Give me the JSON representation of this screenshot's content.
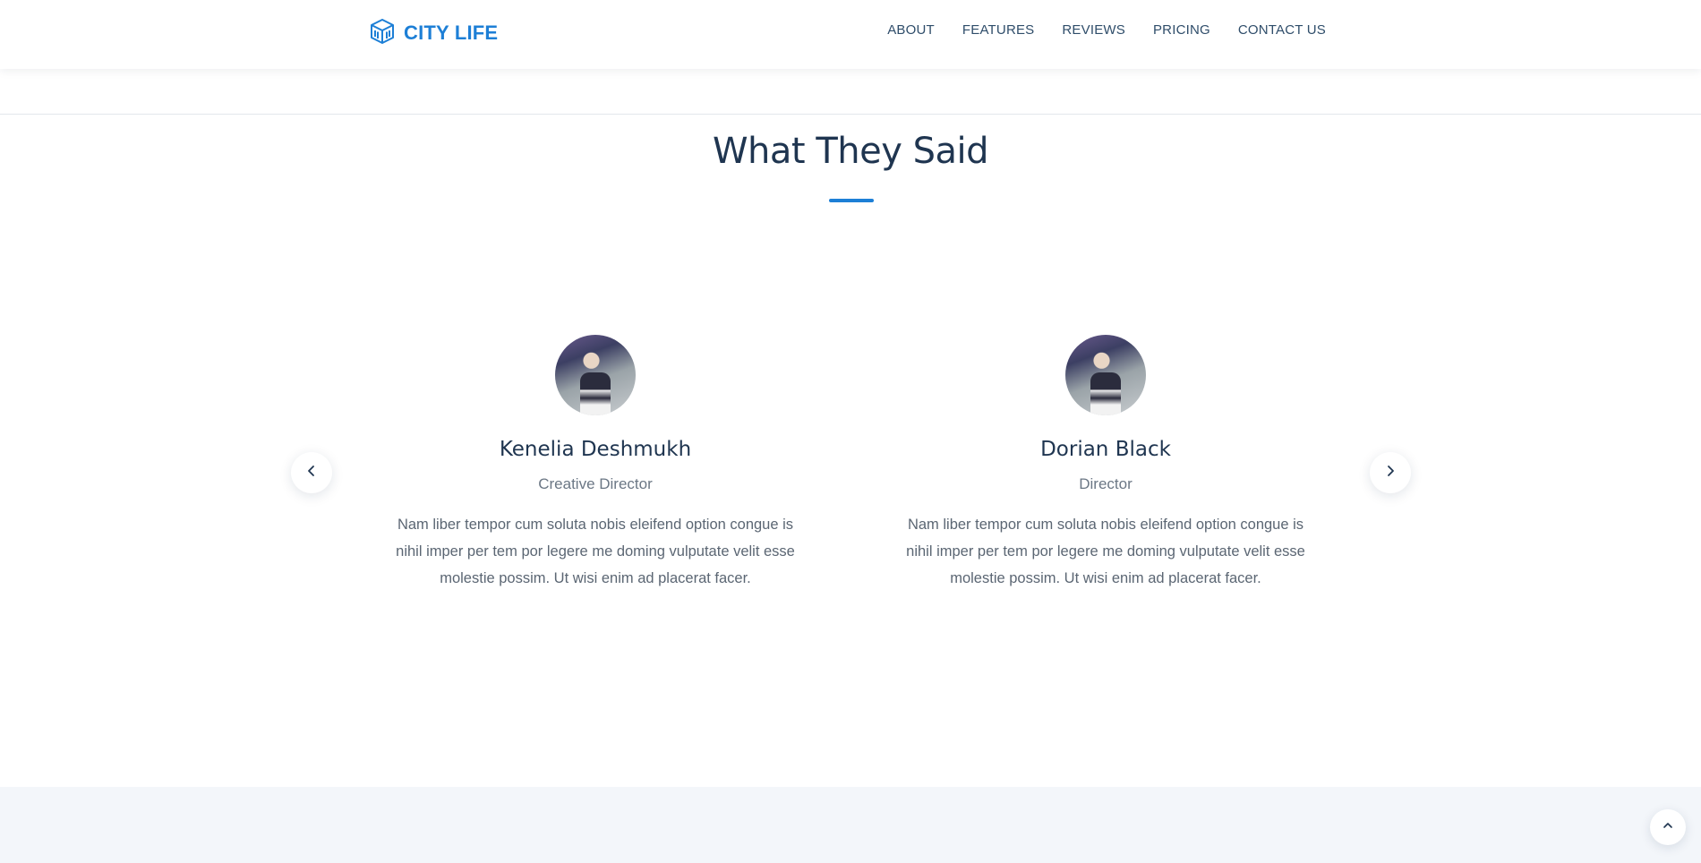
{
  "brand": {
    "name": "CITY LIFE",
    "logo_icon": "building-cube-icon",
    "color": "#1d7fd6"
  },
  "nav": {
    "items": [
      {
        "label": "ABOUT"
      },
      {
        "label": "FEATURES"
      },
      {
        "label": "REVIEWS"
      },
      {
        "label": "PRICING"
      },
      {
        "label": "CONTACT US"
      }
    ]
  },
  "testimonials": {
    "title": "What They Said",
    "prev_icon": "chevron-left-icon",
    "next_icon": "chevron-right-icon",
    "items": [
      {
        "name": "Kenelia Deshmukh",
        "role": "Creative Director",
        "quote": "Nam liber tempor cum soluta nobis eleifend option congue is nihil imper per tem por legere me doming vulputate velit esse molestie possim. Ut wisi enim ad placerat facer."
      },
      {
        "name": "Dorian Black",
        "role": "Director",
        "quote": "Nam liber tempor cum soluta nobis eleifend option congue is nihil imper per tem por legere me doming vulputate velit esse molestie possim. Ut wisi enim ad placerat facer."
      }
    ]
  },
  "scroll_top": {
    "icon": "chevron-up-icon"
  },
  "colors": {
    "accent": "#1d7fd6",
    "heading": "#1f3550",
    "body_text": "#5b6673",
    "band": "#f3f6fa"
  }
}
